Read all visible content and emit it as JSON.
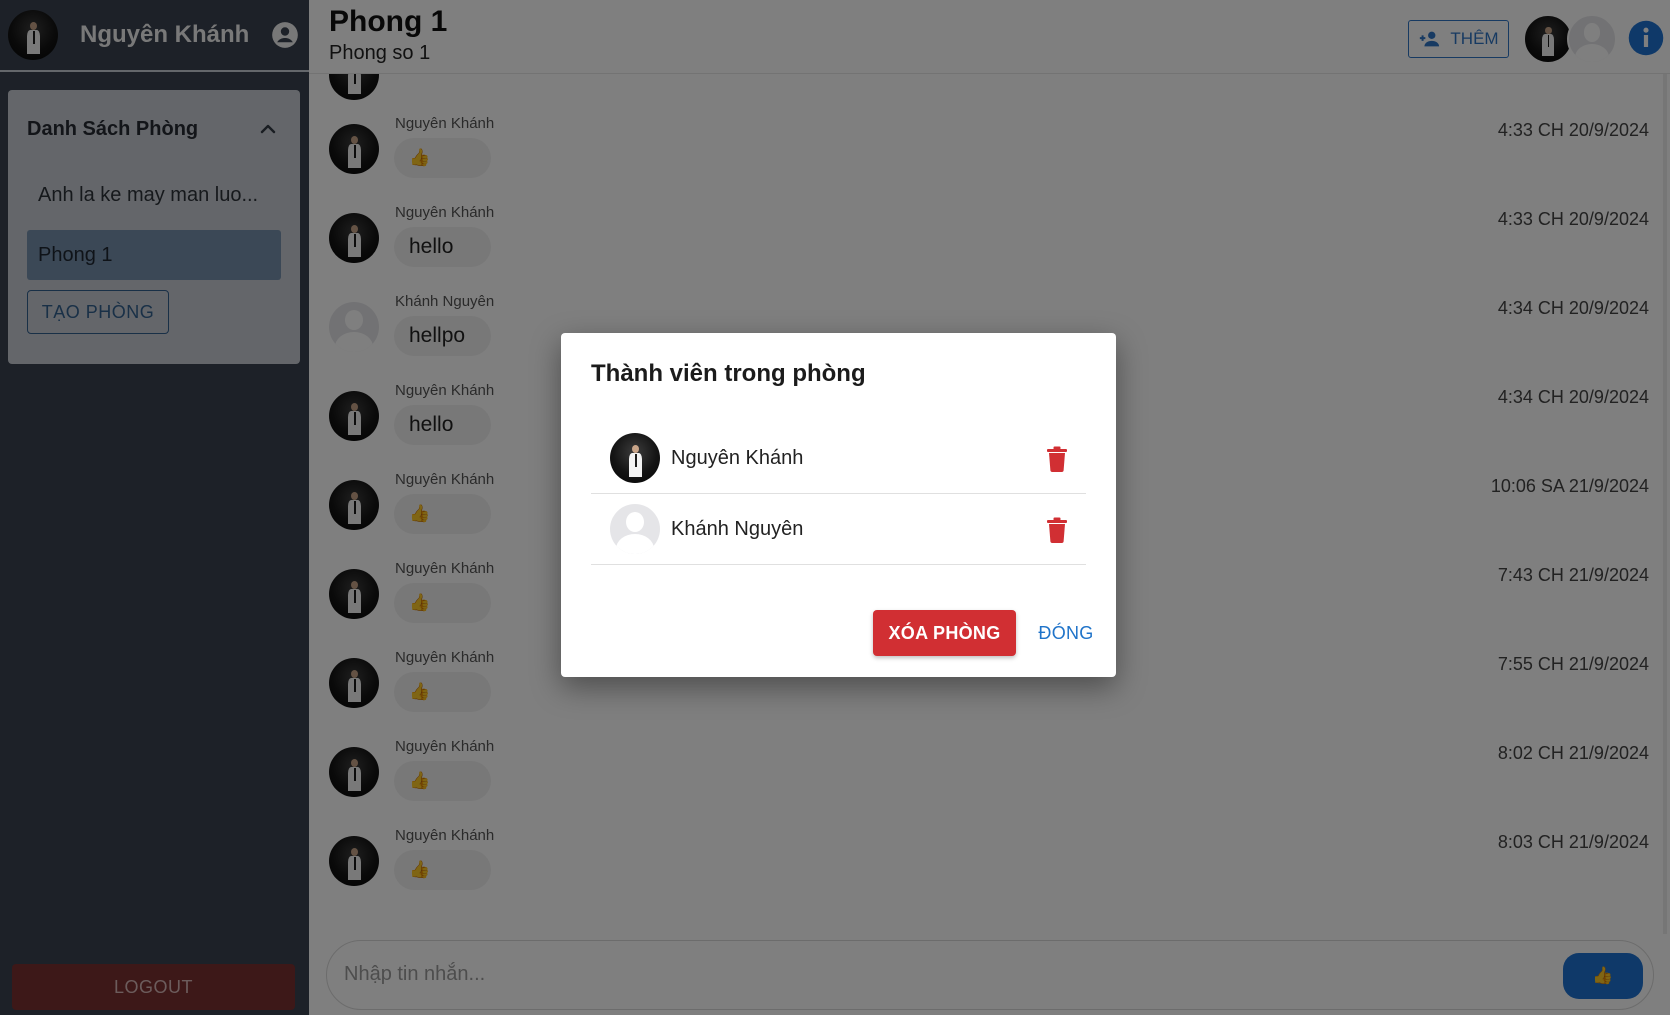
{
  "sidebar": {
    "username": "Nguyên Khánh",
    "room_list_title": "Danh Sách Phòng",
    "rooms": [
      {
        "label": "Anh la ke may man luo...",
        "active": false
      },
      {
        "label": "Phong 1",
        "active": true
      }
    ],
    "create_room_label": "TẠO PHÒNG",
    "logout_label": "LOGOUT"
  },
  "header": {
    "room_name": "Phong 1",
    "room_description": "Phong so 1",
    "add_member_label": "THÊM"
  },
  "messages": [
    {
      "author": "",
      "content": "👍",
      "time": "",
      "avatar": "photo"
    },
    {
      "author": "Nguyên Khánh",
      "content": "👍",
      "time": "4:33 CH 20/9/2024",
      "avatar": "photo"
    },
    {
      "author": "Nguyên Khánh",
      "content": "hello",
      "time": "4:33 CH 20/9/2024",
      "avatar": "photo"
    },
    {
      "author": "Khánh Nguyên",
      "content": "hellpo",
      "time": "4:34 CH 20/9/2024",
      "avatar": "blank"
    },
    {
      "author": "Nguyên Khánh",
      "content": "hello",
      "time": "4:34 CH 20/9/2024",
      "avatar": "photo"
    },
    {
      "author": "Nguyên Khánh",
      "content": "👍",
      "time": "10:06 SA 21/9/2024",
      "avatar": "photo"
    },
    {
      "author": "Nguyên Khánh",
      "content": "👍",
      "time": "7:43 CH 21/9/2024",
      "avatar": "photo"
    },
    {
      "author": "Nguyên Khánh",
      "content": "👍",
      "time": "7:55 CH 21/9/2024",
      "avatar": "photo"
    },
    {
      "author": "Nguyên Khánh",
      "content": "👍",
      "time": "8:02 CH 21/9/2024",
      "avatar": "photo"
    },
    {
      "author": "Nguyên Khánh",
      "content": "👍",
      "time": "8:03 CH 21/9/2024",
      "avatar": "photo"
    }
  ],
  "composer": {
    "placeholder": "Nhập tin nhắn...",
    "send_icon": "thumbs-up-icon"
  },
  "modal": {
    "title": "Thành viên trong phòng",
    "members": [
      {
        "name": "Nguyên Khánh",
        "avatar": "photo"
      },
      {
        "name": "Khánh Nguyên",
        "avatar": "blank"
      }
    ],
    "delete_room_label": "XÓA PHÒNG",
    "close_label": "ĐÓNG"
  },
  "colors": {
    "sidebar_bg": "#3a4350",
    "accent_blue": "#1f73c9",
    "danger_red": "#d12f33",
    "active_room_bg": "#7790ad"
  }
}
